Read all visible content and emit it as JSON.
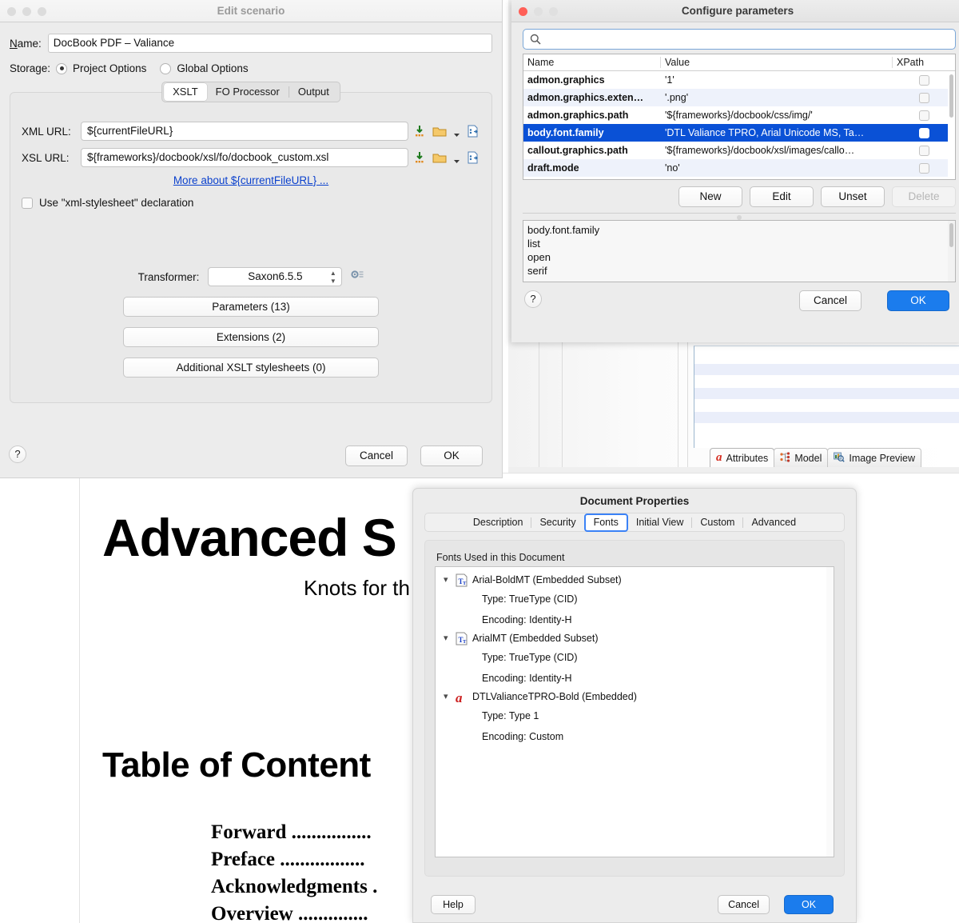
{
  "editor": {
    "tabs": [
      {
        "label": "Attributes",
        "icon": "alpha-icon",
        "active": true
      },
      {
        "label": "Model",
        "icon": "model-icon",
        "active": false
      },
      {
        "label": "Image Preview",
        "icon": "image-preview-icon",
        "active": false
      }
    ]
  },
  "pdf": {
    "title": "Advanced S",
    "subtitle": "Knots for th",
    "toc_title": "Table of Content",
    "toc_entries": [
      "Forward ................",
      "Preface .................",
      "Acknowledgments .",
      "Overview .............."
    ]
  },
  "edit_scenario": {
    "title": "Edit scenario",
    "name_label": "Name:",
    "name_value": "DocBook PDF – Valiance",
    "storage_label": "Storage:",
    "storage_options": [
      {
        "label": "Project Options",
        "selected": true
      },
      {
        "label": "Global Options",
        "selected": false
      }
    ],
    "tabs": [
      {
        "label": "XSLT",
        "active": true
      },
      {
        "label": "FO Processor",
        "active": false
      },
      {
        "label": "Output",
        "active": false
      }
    ],
    "xml_url_label": "XML URL:",
    "xml_url_value": "${currentFileURL}",
    "xsl_url_label": "XSL URL:",
    "xsl_url_value": "${frameworks}/docbook/xsl/fo/docbook_custom.xsl",
    "more_link": "More about ${currentFileURL} ...",
    "stylesheet_checkbox_label": "Use \"xml-stylesheet\" declaration",
    "stylesheet_checked": false,
    "transformer_label": "Transformer:",
    "transformer_value": "Saxon6.5.5",
    "buttons": [
      "Parameters (13)",
      "Extensions (2)",
      "Additional XSLT stylesheets (0)"
    ],
    "help_label": "?",
    "cancel_label": "Cancel",
    "ok_label": "OK"
  },
  "configure_parameters": {
    "title": "Configure parameters",
    "search_placeholder": "",
    "search_value": "",
    "columns": [
      "Name",
      "Value",
      "XPath"
    ],
    "rows": [
      {
        "name": "admon.graphics",
        "value": "'1'",
        "xpath": false,
        "selected": false
      },
      {
        "name": "admon.graphics.exten…",
        "value": "'.png'",
        "xpath": false,
        "selected": false
      },
      {
        "name": "admon.graphics.path",
        "value": "'${frameworks}/docbook/css/img/'",
        "xpath": false,
        "selected": false
      },
      {
        "name": "body.font.family",
        "value": "'DTL Valiance TPRO, Arial Unicode MS, Ta…",
        "xpath": false,
        "selected": true
      },
      {
        "name": "callout.graphics.path",
        "value": "'${frameworks}/docbook/xsl/images/callo…",
        "xpath": false,
        "selected": false
      },
      {
        "name": "draft.mode",
        "value": "'no'",
        "xpath": false,
        "selected": false
      }
    ],
    "action_buttons": [
      {
        "label": "New",
        "disabled": false
      },
      {
        "label": "Edit",
        "disabled": false
      },
      {
        "label": "Unset",
        "disabled": false
      },
      {
        "label": "Delete",
        "disabled": true
      }
    ],
    "description_lines": [
      "body.font.family",
      "list",
      "open",
      "serif"
    ],
    "help_label": "?",
    "cancel_label": "Cancel",
    "ok_label": "OK"
  },
  "document_properties": {
    "title": "Document Properties",
    "tabs": [
      {
        "label": "Description",
        "active": false
      },
      {
        "label": "Security",
        "active": false
      },
      {
        "label": "Fonts",
        "active": true
      },
      {
        "label": "Initial View",
        "active": false
      },
      {
        "label": "Custom",
        "active": false
      },
      {
        "label": "Advanced",
        "active": false
      }
    ],
    "legend": "Fonts Used in this Document",
    "fonts": [
      {
        "name": "Arial-BoldMT (Embedded Subset)",
        "icon": "truetype-font-icon",
        "details": [
          "Type: TrueType (CID)",
          "Encoding: Identity-H"
        ]
      },
      {
        "name": "ArialMT (Embedded Subset)",
        "icon": "truetype-font-icon",
        "details": [
          "Type: TrueType (CID)",
          "Encoding: Identity-H"
        ]
      },
      {
        "name": "DTLValianceTPRO-Bold (Embedded)",
        "icon": "type1-font-icon",
        "details": [
          "Type: Type 1",
          "Encoding: Custom"
        ]
      }
    ],
    "help_label": "Help",
    "cancel_label": "Cancel",
    "ok_label": "OK"
  },
  "colors": {
    "selection_blue": "#0a51d6",
    "primary_blue": "#1b7ced",
    "link_blue": "#0b41cd",
    "focus_ring": "#3b82f6"
  }
}
